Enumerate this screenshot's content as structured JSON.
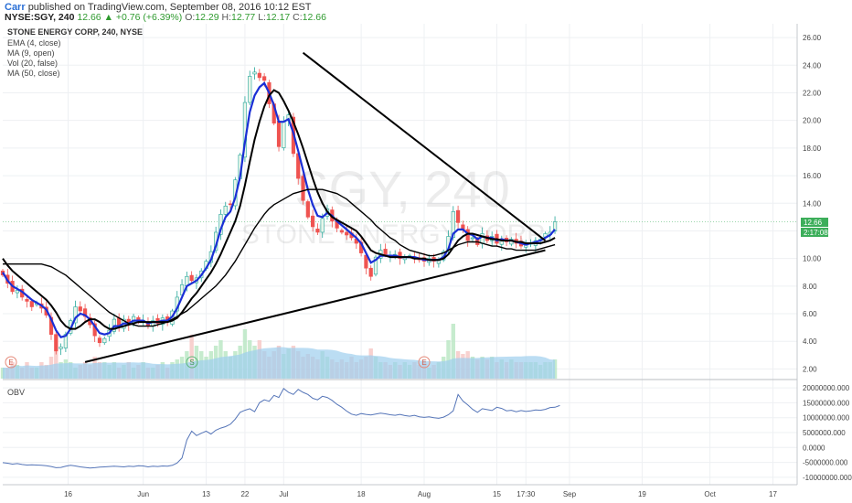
{
  "header": {
    "author": "Carr",
    "published_text": "published on TradingView.com, September 08, 2016 10:12 EST",
    "symbol_line": "NYSE:SGY, 240",
    "last": "12.66",
    "change": "▲ +0.76 (+6.39%)",
    "o_label": "O:",
    "o": "12.29",
    "h_label": "H:",
    "h": "12.77",
    "l_label": "L:",
    "l": "12.17",
    "c_label": "C:",
    "c": "12.66"
  },
  "legend": {
    "title": "STONE ENERGY CORP, 240, NYSE",
    "indicators": [
      "EMA (4, close)",
      "MA (9, open)",
      "Vol (20, false)",
      "MA (50, close)"
    ]
  },
  "watermark": {
    "symbol": "SGY, 240",
    "name": "STONE ENERGY CORP"
  },
  "price_badges": {
    "price": "12.66",
    "countdown": "2:17:08"
  },
  "events": [
    "E",
    "S",
    "E"
  ],
  "colors": {
    "up": "#26a69a",
    "down": "#ef5350",
    "ema": "#1a2fd6",
    "ma": "#000000",
    "volume": "#9ecfee",
    "obv": "#5575b8",
    "badge": "#3cae5a"
  },
  "chart_data": [
    {
      "type": "candlestick",
      "title": "STONE ENERGY CORP, 240, NYSE",
      "y_ticks": [
        "2.00",
        "4.00",
        "6.00",
        "8.00",
        "10.00",
        "12.00",
        "14.00",
        "16.00",
        "18.00",
        "20.00",
        "22.00",
        "24.00",
        "26.00"
      ],
      "ylim": [
        1.3,
        27
      ],
      "x_ticks": [
        {
          "label": "16",
          "x": 13.5
        },
        {
          "label": "Jun",
          "x": 29
        },
        {
          "label": "13",
          "x": 42
        },
        {
          "label": "22",
          "x": 50
        },
        {
          "label": "Jul",
          "x": 58
        },
        {
          "label": "18",
          "x": 74
        },
        {
          "label": "Aug",
          "x": 87
        },
        {
          "label": "15",
          "x": 102
        },
        {
          "label": "17:30",
          "x": 108
        },
        {
          "label": "Sep",
          "x": 117
        },
        {
          "label": "19",
          "x": 132
        },
        {
          "label": "Oct",
          "x": 146
        },
        {
          "label": "17",
          "x": 159
        }
      ],
      "xlim": [
        0,
        164
      ],
      "close": [
        8.8,
        8.2,
        7.6,
        7.7,
        7.2,
        6.9,
        6.5,
        6.8,
        6.4,
        5.9,
        4.5,
        3.3,
        3.6,
        4.5,
        5.5,
        6.5,
        6.2,
        5.8,
        5.2,
        4.4,
        3.9,
        4.2,
        4.8,
        5.6,
        5.1,
        5.6,
        5.2,
        5.8,
        5.4,
        5.5,
        5.1,
        5.5,
        5.3,
        5.7,
        5.4,
        6.2,
        7.2,
        8.1,
        8.7,
        8.4,
        8.6,
        9.1,
        9.8,
        10.5,
        11.9,
        13.2,
        13.8,
        13.9,
        15.7,
        17.5,
        21.3,
        23.2,
        23.5,
        23.1,
        22.9,
        21.2,
        19.8,
        18.1,
        19.9,
        20.4,
        17.6,
        15.8,
        14.2,
        13.0,
        12.3,
        11.9,
        12.9,
        13.6,
        12.7,
        12.2,
        11.9,
        11.7,
        11.5,
        11.1,
        10.4,
        9.3,
        8.7,
        10.1,
        10.6,
        10.3,
        10.2,
        10.3,
        10.0,
        10.1,
        10.2,
        10.0,
        9.9,
        9.8,
        10.0,
        9.8,
        9.9,
        10.5,
        11.6,
        13.4,
        12.6,
        12.1,
        11.3,
        11.5,
        11.0,
        11.8,
        11.3,
        11.6,
        11.1,
        11.4,
        11.2,
        11.4,
        11.1,
        10.9,
        11.0,
        11.1,
        11.3,
        11.4,
        11.8,
        11.9,
        12.66
      ],
      "series": [
        {
          "name": "EMA (4, close)",
          "values": [
            9.0,
            8.4,
            8.0,
            7.8,
            7.6,
            7.3,
            7.0,
            6.8,
            6.6,
            6.3,
            5.6,
            4.8,
            4.3,
            4.4,
            4.9,
            5.7,
            6.0,
            5.9,
            5.6,
            5.1,
            4.6,
            4.5,
            4.6,
            5.1,
            5.1,
            5.3,
            5.3,
            5.5,
            5.5,
            5.5,
            5.3,
            5.4,
            5.4,
            5.5,
            5.5,
            5.8,
            6.4,
            7.2,
            8.0,
            8.2,
            8.4,
            8.8,
            9.3,
            9.9,
            10.9,
            12.1,
            13.0,
            13.4,
            14.4,
            15.9,
            18.4,
            20.6,
            21.8,
            22.4,
            22.7,
            22.0,
            21.1,
            19.9,
            19.9,
            20.1,
            19.1,
            17.8,
            16.4,
            15.0,
            13.9,
            13.1,
            13.0,
            13.3,
            13.1,
            12.7,
            12.4,
            12.1,
            11.8,
            11.5,
            11.1,
            10.4,
            9.7,
            9.9,
            10.2,
            10.2,
            10.2,
            10.2,
            10.1,
            10.1,
            10.1,
            10.1,
            10.0,
            9.9,
            9.9,
            9.9,
            9.9,
            10.1,
            10.7,
            11.8,
            12.1,
            12.1,
            11.8,
            11.7,
            11.4,
            11.6,
            11.5,
            11.5,
            11.3,
            11.4,
            11.3,
            11.3,
            11.2,
            11.1,
            11.0,
            11.1,
            11.2,
            11.3,
            11.5,
            11.7,
            12.1
          ]
        },
        {
          "name": "MA (9, open)",
          "values": [
            10.0,
            9.5,
            9.1,
            8.8,
            8.5,
            8.2,
            7.9,
            7.6,
            7.3,
            7.0,
            6.6,
            6.1,
            5.5,
            5.1,
            4.9,
            4.9,
            5.1,
            5.4,
            5.6,
            5.6,
            5.4,
            5.1,
            4.9,
            4.9,
            5.0,
            5.1,
            5.2,
            5.3,
            5.4,
            5.4,
            5.4,
            5.4,
            5.4,
            5.4,
            5.4,
            5.5,
            5.7,
            6.1,
            6.6,
            7.1,
            7.5,
            8.0,
            8.5,
            9.0,
            9.6,
            10.3,
            11.1,
            11.9,
            12.7,
            13.8,
            15.3,
            17.0,
            18.6,
            19.9,
            21.0,
            21.8,
            22.2,
            22.0,
            21.4,
            20.7,
            19.9,
            19.0,
            18.0,
            16.9,
            15.8,
            14.8,
            14.0,
            13.4,
            13.0,
            12.8,
            12.6,
            12.4,
            12.2,
            12.0,
            11.6,
            11.1,
            10.6,
            10.4,
            10.3,
            10.2,
            10.1,
            10.1,
            10.1,
            10.1,
            10.1,
            10.0,
            10.0,
            10.0,
            9.9,
            9.9,
            9.9,
            10.0,
            10.3,
            10.8,
            11.3,
            11.6,
            11.8,
            11.8,
            11.7,
            11.6,
            11.5,
            11.4,
            11.4,
            11.3,
            11.3,
            11.3,
            11.2,
            11.2,
            11.1,
            11.1,
            11.1,
            11.1,
            11.2,
            11.3,
            11.5
          ]
        },
        {
          "name": "MA (50, close)",
          "values": [
            9.6,
            9.6,
            9.6,
            9.6,
            9.6,
            9.6,
            9.6,
            9.6,
            9.6,
            9.5,
            9.4,
            9.2,
            9.0,
            8.8,
            8.5,
            8.2,
            7.9,
            7.6,
            7.3,
            7.0,
            6.7,
            6.4,
            6.1,
            5.9,
            5.7,
            5.5,
            5.3,
            5.2,
            5.1,
            5.1,
            5.1,
            5.1,
            5.2,
            5.3,
            5.4,
            5.6,
            5.8,
            6.0,
            6.2,
            6.5,
            6.8,
            7.1,
            7.4,
            7.7,
            8.0,
            8.4,
            8.8,
            9.3,
            9.8,
            10.4,
            11.0,
            11.6,
            12.2,
            12.7,
            13.2,
            13.6,
            13.9,
            14.1,
            14.3,
            14.5,
            14.7,
            14.8,
            14.9,
            15.0,
            15.0,
            15.0,
            15.0,
            14.9,
            14.8,
            14.7,
            14.5,
            14.3,
            14.0,
            13.7,
            13.4,
            13.1,
            12.8,
            12.4,
            12.1,
            11.8,
            11.5,
            11.3,
            11.0,
            10.8,
            10.6,
            10.5,
            10.4,
            10.3,
            10.2,
            10.2,
            10.3,
            10.4,
            10.6,
            10.8,
            11.0,
            11.1,
            11.2,
            11.2,
            11.2,
            11.1,
            11.0,
            10.9,
            10.9,
            10.8,
            10.7,
            10.7,
            10.6,
            10.6,
            10.6,
            10.6,
            10.6,
            10.7,
            10.8,
            10.9,
            11.0
          ]
        }
      ],
      "volume_ratio": [
        0.2,
        0.2,
        0.3,
        0.25,
        0.2,
        0.3,
        0.2,
        0.2,
        0.3,
        0.25,
        0.4,
        0.5,
        0.3,
        0.35,
        0.3,
        0.2,
        0.25,
        0.3,
        0.25,
        0.4,
        0.3,
        0.3,
        0.25,
        0.3,
        0.2,
        0.25,
        0.3,
        0.2,
        0.25,
        0.3,
        0.2,
        0.2,
        0.25,
        0.3,
        0.2,
        0.3,
        0.35,
        0.4,
        0.5,
        0.8,
        0.6,
        0.5,
        0.4,
        0.5,
        0.6,
        0.7,
        0.5,
        0.4,
        0.5,
        0.6,
        0.9,
        0.7,
        0.6,
        0.7,
        0.5,
        0.4,
        0.5,
        0.6,
        0.45,
        0.55,
        0.6,
        0.5,
        0.4,
        0.45,
        0.4,
        0.35,
        0.5,
        0.4,
        0.35,
        0.3,
        0.35,
        0.3,
        0.4,
        0.3,
        0.35,
        0.4,
        0.55,
        0.4,
        0.3,
        0.3,
        0.25,
        0.3,
        0.25,
        0.3,
        0.25,
        0.3,
        0.25,
        0.3,
        0.2,
        0.25,
        0.3,
        0.4,
        0.7,
        1.0,
        0.5,
        0.45,
        0.5,
        0.4,
        0.35,
        0.4,
        0.35,
        0.4,
        0.3,
        0.35,
        0.3,
        0.35,
        0.3,
        0.3,
        0.3,
        0.3,
        0.3,
        0.25,
        0.3,
        0.3,
        0.35
      ],
      "trendlines": [
        {
          "name": "resistance",
          "from": [
            62,
            24.9
          ],
          "to": [
            112,
            11.3
          ]
        },
        {
          "name": "support",
          "from": [
            17,
            2.5
          ],
          "to": [
            112,
            10.6
          ]
        }
      ]
    },
    {
      "type": "line",
      "title": "OBV",
      "y_ticks": [
        "20000000.000",
        "15000000.000",
        "10000000.000",
        "5000000.000",
        "0.0000",
        "-5000000.000",
        "-10000000.000"
      ],
      "ylim": [
        -12500000,
        22500000
      ],
      "values": [
        -5100000,
        -5300000,
        -5600000,
        -5400000,
        -5700000,
        -5900000,
        -5800000,
        -5900000,
        -6000000,
        -6100000,
        -6400000,
        -6800000,
        -6700000,
        -6300000,
        -6000000,
        -6200000,
        -6500000,
        -6700000,
        -6900000,
        -6800000,
        -6600000,
        -6500000,
        -6400000,
        -6300000,
        -6400000,
        -6500000,
        -6300000,
        -6400000,
        -6100000,
        -6200000,
        -6500000,
        -6300000,
        -6400000,
        -6200000,
        -6300000,
        -6000000,
        -5200000,
        -3500000,
        2500000,
        5500000,
        4000000,
        4800000,
        5500000,
        4500000,
        5800000,
        6500000,
        7000000,
        7800000,
        9500000,
        11800000,
        12500000,
        13000000,
        12000000,
        15000000,
        16000000,
        15500000,
        17500000,
        16800000,
        19800000,
        18500000,
        17800000,
        19500000,
        18500000,
        17800000,
        16500000,
        16000000,
        17200000,
        16800000,
        15800000,
        14500000,
        13500000,
        12200000,
        11200000,
        10800000,
        11400000,
        11100000,
        10900000,
        11200000,
        11500000,
        11300000,
        11000000,
        10800000,
        11100000,
        10700000,
        10500000,
        10800000,
        10300000,
        10100000,
        10300000,
        10000000,
        9800000,
        10200000,
        11000000,
        12300000,
        17800000,
        15600000,
        14300000,
        12800000,
        11800000,
        13000000,
        12700000,
        12400000,
        13500000,
        13100000,
        12300000,
        12500000,
        12000000,
        12400000,
        12100000,
        12300000,
        12600000,
        12500000,
        12800000,
        13400000,
        13500000,
        14100000
      ]
    }
  ]
}
